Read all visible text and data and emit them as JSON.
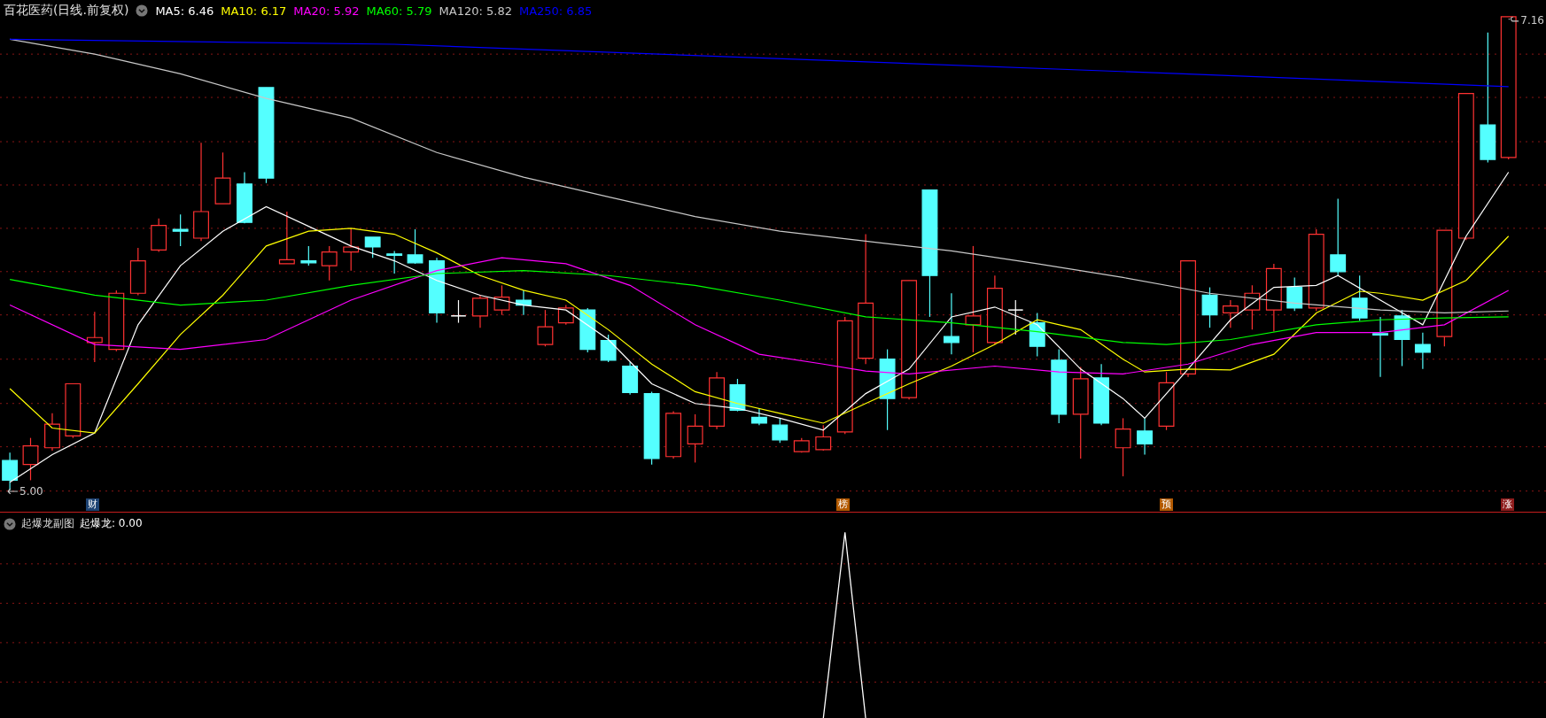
{
  "header": {
    "title": "百花医药(日线.前复权)",
    "indicators": [
      {
        "label": "MA5: 6.46",
        "color": "#ffffff"
      },
      {
        "label": "MA10: 6.17",
        "color": "#ffff00"
      },
      {
        "label": "MA20: 5.92",
        "color": "#ff00ff"
      },
      {
        "label": "MA60: 5.79",
        "color": "#00ff00"
      },
      {
        "label": "MA120: 5.82",
        "color": "#c8c8c8"
      },
      {
        "label": "MA250: 6.85",
        "color": "#0000ff"
      }
    ]
  },
  "price_labels": {
    "high": "7.16",
    "low": "5.00"
  },
  "event_markers": [
    {
      "label": "财",
      "color": "#1d4373"
    },
    {
      "label": "榜",
      "color": "#b35a00"
    },
    {
      "label": "预",
      "color": "#b35a00"
    },
    {
      "label": "涨",
      "color": "#8e1c1c"
    }
  ],
  "sub_chart": {
    "title": "起爆龙副图",
    "indicator": "起爆龙: 0.00"
  }
}
